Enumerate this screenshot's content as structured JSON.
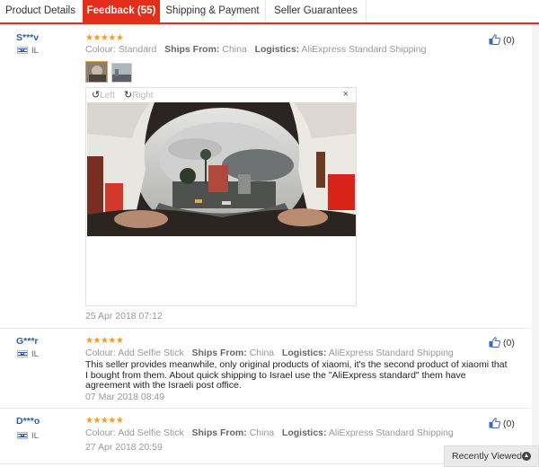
{
  "tabs": [
    {
      "label": "Product Details"
    },
    {
      "label": "Feedback (55)"
    },
    {
      "label": "Shipping & Payment"
    },
    {
      "label": "Seller Guarantees"
    }
  ],
  "labels": {
    "colour": "Colour:",
    "ships_from": "Ships From:",
    "logistics": "Logistics:"
  },
  "reviews": [
    {
      "buyer": "S***v",
      "country": "IL",
      "stars": "★★★★★",
      "colour": "Standard",
      "ships_from": "China",
      "logistics": "AliExpress Standard Shipping",
      "helpful": "(0)",
      "date": "25 Apr 2018 07:12",
      "text": ""
    },
    {
      "buyer": "G***r",
      "country": "IL",
      "stars": "★★★★★",
      "colour": "Add Selfie Stick",
      "ships_from": "China",
      "logistics": "AliExpress Standard Shipping",
      "helpful": "(0)",
      "date": "07 Mar 2018 08:49",
      "text": "This seller provides meanwhile, only original products of xiaomi, it's the second product of xiaomi that I bought from them. About quick shipping to Israel use the \"AliExpress standard\" them have agreement with the Israeli post office."
    },
    {
      "buyer": "D***o",
      "country": "IL",
      "stars": "★★★★★",
      "colour": "Add Selfie Stick",
      "ships_from": "China",
      "logistics": "AliExpress Standard Shipping",
      "helpful": "(0)",
      "date": "27 Apr 2018 20:59",
      "text": ""
    }
  ],
  "viewer": {
    "rotate_left": "Left",
    "rotate_right": "Right",
    "close": "×"
  },
  "recently_viewed": "Recently Viewed",
  "colors": {
    "accent": "#e52d1c",
    "star": "#f39c1d",
    "buyer_link": "#2b5ea8"
  }
}
